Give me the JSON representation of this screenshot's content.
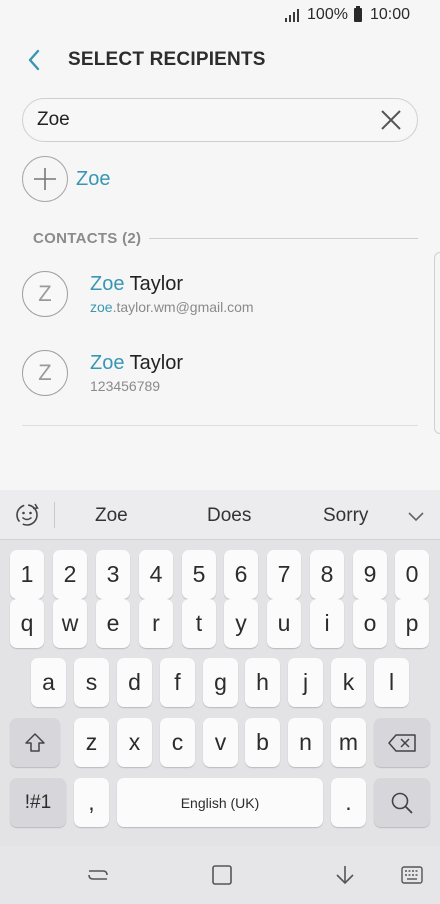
{
  "status_bar": {
    "battery": "100%",
    "time": "10:00"
  },
  "header": {
    "title": "SELECT RECIPIENTS"
  },
  "search": {
    "value": "Zoe",
    "placeholder": ""
  },
  "add_recipient": {
    "label": "Zoe"
  },
  "contacts_section": {
    "title": "CONTACTS (2)"
  },
  "contacts": [
    {
      "avatar": "Z",
      "name_match": "Zoe",
      "name_rest": " Taylor",
      "sub_match": "zoe",
      "sub_rest": ".taylor.wm@gmail.com"
    },
    {
      "avatar": "Z",
      "name_match": "Zoe",
      "name_rest": " Taylor",
      "sub_match": "",
      "sub_rest": "123456789"
    }
  ],
  "keyboard": {
    "suggestions": [
      "Zoe",
      "Does",
      "Sorry"
    ],
    "number_row": [
      "1",
      "2",
      "3",
      "4",
      "5",
      "6",
      "7",
      "8",
      "9",
      "0"
    ],
    "row1": [
      "q",
      "w",
      "e",
      "r",
      "t",
      "y",
      "u",
      "i",
      "o",
      "p"
    ],
    "row2": [
      "a",
      "s",
      "d",
      "f",
      "g",
      "h",
      "j",
      "k",
      "l"
    ],
    "row3": [
      "z",
      "x",
      "c",
      "v",
      "b",
      "n",
      "m"
    ],
    "symbols_label": "!#1",
    "comma_label": ",",
    "space_label": "English (UK)",
    "period_label": "."
  },
  "icons": {
    "back": "chevron-left-icon",
    "clear": "close-icon",
    "add": "plus-icon",
    "emoji": "emoji-refresh-icon",
    "collapse": "chevron-down-icon",
    "shift": "shift-icon",
    "backspace": "backspace-icon",
    "search": "search-icon"
  },
  "colors": {
    "accent": "#3996b3"
  }
}
